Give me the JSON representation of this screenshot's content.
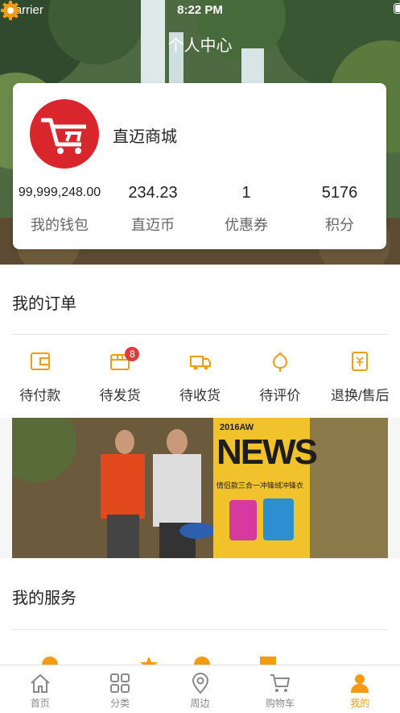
{
  "status_bar": {
    "carrier": "Carrier",
    "time": "8:22 PM"
  },
  "nav": {
    "title": "个人中心"
  },
  "profile": {
    "shop_name": "直迈商城",
    "stats": [
      {
        "value": "99,999,248.00",
        "label": "我的钱包"
      },
      {
        "value": "234.23",
        "label": "直迈币"
      },
      {
        "value": "1",
        "label": "优惠券"
      },
      {
        "value": "5176",
        "label": "积分"
      }
    ]
  },
  "orders": {
    "title": "我的订单",
    "items": [
      {
        "label": "待付款",
        "icon": "wallet-icon"
      },
      {
        "label": "待发货",
        "icon": "box-icon",
        "badge": "8"
      },
      {
        "label": "待收货",
        "icon": "truck-icon"
      },
      {
        "label": "待评价",
        "icon": "flower-icon"
      },
      {
        "label": "退换/售后",
        "icon": "refund-icon"
      }
    ]
  },
  "banner": {
    "year": "2016AW",
    "headline": "NEWS",
    "caption": "情侣款三合一冲锋绒冲锋衣"
  },
  "services": {
    "title": "我的服务"
  },
  "tabs": [
    {
      "label": "首页",
      "icon": "home-icon"
    },
    {
      "label": "分类",
      "icon": "grid-icon"
    },
    {
      "label": "周边",
      "icon": "location-icon"
    },
    {
      "label": "购物车",
      "icon": "cart-icon"
    },
    {
      "label": "我的",
      "icon": "user-icon",
      "active": true
    }
  ],
  "colors": {
    "accent": "#f39c12",
    "logo_red": "#d9262c",
    "badge_red": "#e03c3c"
  }
}
